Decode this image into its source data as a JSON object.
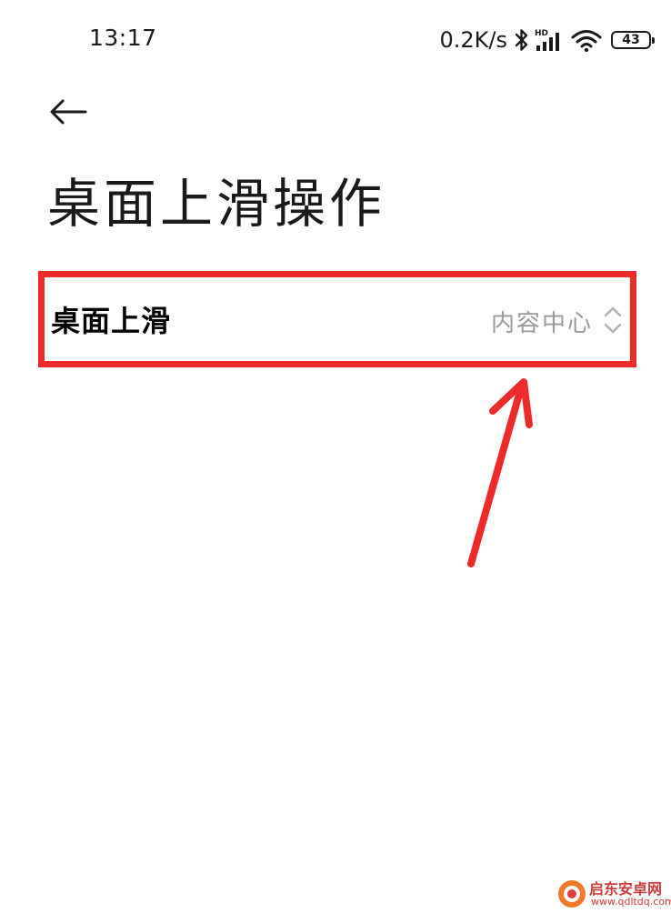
{
  "status_bar": {
    "time": "13:17",
    "net_speed": "0.2K/s",
    "icons": [
      "bluetooth-icon",
      "hd-signal-icon",
      "wifi-icon",
      "battery-icon"
    ],
    "battery_level": "43"
  },
  "header": {
    "back_icon": "arrow-left-icon",
    "title": "桌面上滑操作"
  },
  "settings": {
    "swipe_up": {
      "label": "桌面上滑",
      "value": "内容中心",
      "icon": "chevron-up-down-icon"
    }
  },
  "annotation": {
    "highlight_color": "#ee2b2b",
    "arrow_color": "#ee2b2b"
  },
  "watermark": {
    "name": "启东安卓网",
    "url": "www.qdltdq.com"
  },
  "colors": {
    "background": "#ffffff",
    "text_primary": "#1a1a1a",
    "text_secondary": "#9a9a9a",
    "accent_red": "#ee2b2b"
  }
}
